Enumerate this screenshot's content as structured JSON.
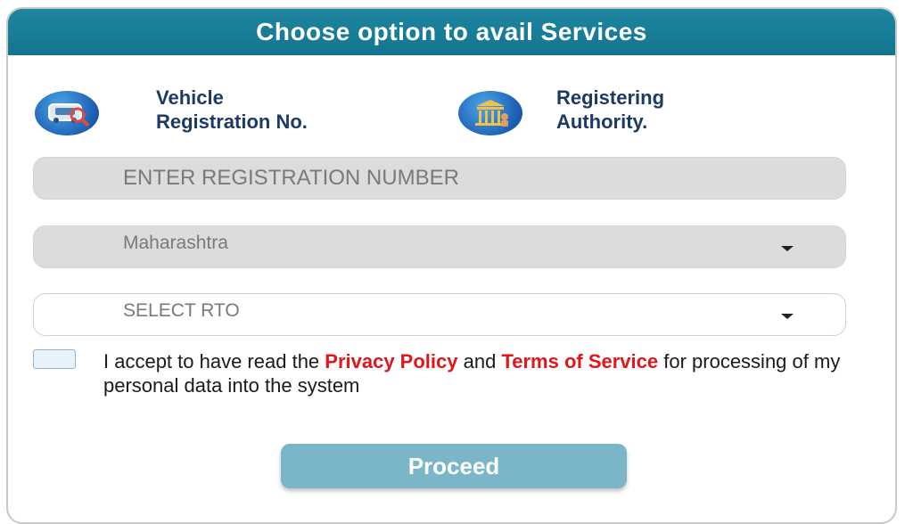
{
  "header": {
    "title": "Choose option to avail Services"
  },
  "options": [
    {
      "line1": "Vehicle",
      "line2": "Registration No.",
      "icon": "car-search-icon"
    },
    {
      "line1": "Registering",
      "line2": "Authority.",
      "icon": "government-building-icon"
    }
  ],
  "form": {
    "registration_placeholder": "ENTER REGISTRATION NUMBER",
    "state_value": "Maharashtra",
    "rto_value": "SELECT RTO"
  },
  "consent": {
    "text_before": "I accept to have read the ",
    "privacy_link": "Privacy Policy",
    "text_and": " and ",
    "terms_link": "Terms of Service",
    "text_after": " for processing of my personal data into the system",
    "checked": false
  },
  "proceed_label": "Proceed",
  "colors": {
    "header": "#127590",
    "link": "#e0161b",
    "proceed": "#7ab6c8",
    "label": "#1d3a66"
  }
}
